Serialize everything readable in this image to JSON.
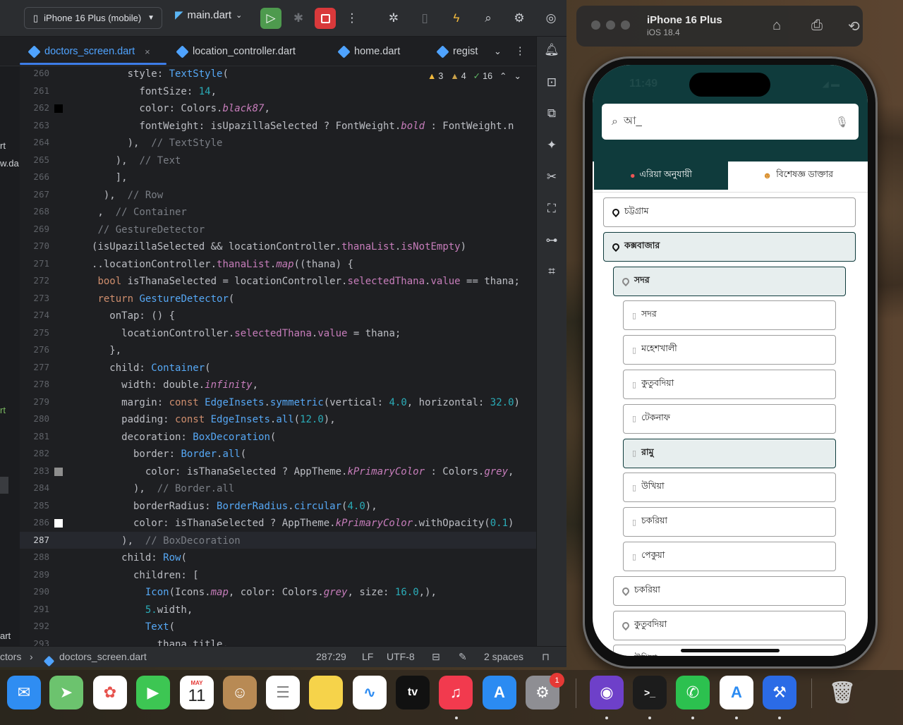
{
  "toolbar": {
    "device": "iPhone 16 Plus (mobile)",
    "run_config": "main.dart"
  },
  "tabs": [
    {
      "label": "doctors_screen.dart"
    },
    {
      "label": "location_controller.dart"
    },
    {
      "label": "home.dart"
    },
    {
      "label": "regist"
    }
  ],
  "inspections": {
    "warnings": "3",
    "weak_warnings": "4",
    "ok": "16"
  },
  "left_fragments": [
    "rt",
    "w.da",
    "rt",
    "art"
  ],
  "code": {
    "current_line": 287,
    "lines": [
      {
        "n": 260,
        "text": "      style: TextStyle("
      },
      {
        "n": 261,
        "text": "        fontSize: 14,"
      },
      {
        "n": 262,
        "text": "        color: Colors.black87,"
      },
      {
        "n": 263,
        "text": "        fontWeight: isUpazillaSelected ? FontWeight.bold : FontWeight.n"
      },
      {
        "n": 264,
        "text": "      ),  // TextStyle"
      },
      {
        "n": 265,
        "text": "    ),  // Text"
      },
      {
        "n": 266,
        "text": "    ],"
      },
      {
        "n": 267,
        "text": "  ),  // Row"
      },
      {
        "n": 268,
        "text": " ,  // Container"
      },
      {
        "n": 269,
        "text": " // GestureDetector"
      },
      {
        "n": 270,
        "text": "(isUpazillaSelected && locationController.thanaList.isNotEmpty)"
      },
      {
        "n": 271,
        "text": "..locationController.thanaList.map((thana) {"
      },
      {
        "n": 272,
        "text": " bool isThanaSelected = locationController.selectedThana.value == thana;"
      },
      {
        "n": 273,
        "text": " return GestureDetector("
      },
      {
        "n": 274,
        "text": "   onTap: () {"
      },
      {
        "n": 275,
        "text": "     locationController.selectedThana.value = thana;"
      },
      {
        "n": 276,
        "text": "   },"
      },
      {
        "n": 277,
        "text": "   child: Container("
      },
      {
        "n": 278,
        "text": "     width: double.infinity,"
      },
      {
        "n": 279,
        "text": "     margin: const EdgeInsets.symmetric(vertical: 4.0, horizontal: 32.0)"
      },
      {
        "n": 280,
        "text": "     padding: const EdgeInsets.all(12.0),"
      },
      {
        "n": 281,
        "text": "     decoration: BoxDecoration("
      },
      {
        "n": 282,
        "text": "       border: Border.all("
      },
      {
        "n": 283,
        "text": "         color: isThanaSelected ? AppTheme.kPrimaryColor : Colors.grey,"
      },
      {
        "n": 284,
        "text": "       ),  // Border.all"
      },
      {
        "n": 285,
        "text": "       borderRadius: BorderRadius.circular(4.0),"
      },
      {
        "n": 286,
        "text": "       color: isThanaSelected ? AppTheme.kPrimaryColor.withOpacity(0.1)"
      },
      {
        "n": 287,
        "text": "     ),  // BoxDecoration"
      },
      {
        "n": 288,
        "text": "     child: Row("
      },
      {
        "n": 289,
        "text": "       children: ["
      },
      {
        "n": 290,
        "text": "         Icon(Icons.map, color: Colors.grey, size: 16.0,),"
      },
      {
        "n": 291,
        "text": "         5.width,"
      },
      {
        "n": 292,
        "text": "         Text("
      },
      {
        "n": 293,
        "text": "           thana.title,"
      }
    ]
  },
  "status": {
    "breadcrumb_prefix": "ctors",
    "file": "doctors_screen.dart",
    "position": "287:29",
    "line_sep": "LF",
    "encoding": "UTF-8",
    "indent": "2 spaces"
  },
  "simulator": {
    "title": "iPhone 16 Plus",
    "subtitle": "iOS 18.4"
  },
  "phone": {
    "time": "11:49",
    "search_text": "আ_",
    "tab_area": "এরিয়া অনুযায়ী",
    "tab_doctor": "বিশেষজ্ঞ ডাক্তার",
    "districts": [
      {
        "label": "চট্টগ্রাম",
        "selected": false
      },
      {
        "label": "কক্সবাজার",
        "selected": true
      }
    ],
    "upazilas_top": [
      {
        "label": "সদর",
        "selected": true
      }
    ],
    "thanas": [
      {
        "label": "সদর",
        "selected": false
      },
      {
        "label": "মহেশখালী",
        "selected": false
      },
      {
        "label": "কুতুবদিয়া",
        "selected": false
      },
      {
        "label": "টেকনাফ",
        "selected": false
      },
      {
        "label": "রামু",
        "selected": true
      },
      {
        "label": "উখিয়া",
        "selected": false
      },
      {
        "label": "চকরিয়া",
        "selected": false
      },
      {
        "label": "পেকুয়া",
        "selected": false
      }
    ],
    "upazilas_bottom": [
      {
        "label": "চকরিয়া"
      },
      {
        "label": "কুতুবদিয়া"
      },
      {
        "label": "উখিয়া"
      }
    ]
  },
  "dock": {
    "calendar_month": "MAY",
    "calendar_day": "11",
    "settings_badge": "1"
  }
}
